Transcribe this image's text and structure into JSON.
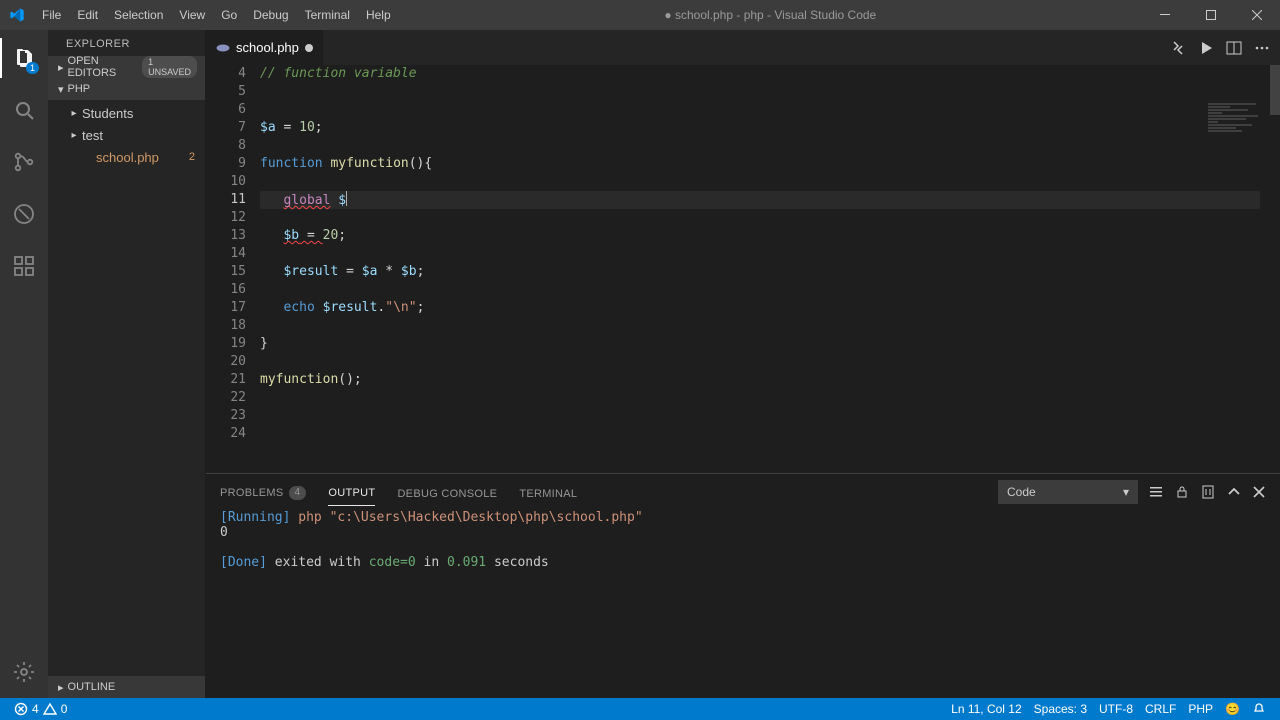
{
  "title": "● school.php - php - Visual Studio Code",
  "menus": [
    "File",
    "Edit",
    "Selection",
    "View",
    "Go",
    "Debug",
    "Terminal",
    "Help"
  ],
  "activity": {
    "explorer_badge": "1"
  },
  "sidebar": {
    "title": "EXPLORER",
    "open_editors": "OPEN EDITORS",
    "unsaved_chip": "1 UNSAVED",
    "root": "PHP",
    "items": [
      {
        "type": "folder",
        "label": "Students"
      },
      {
        "type": "folder",
        "label": "test"
      },
      {
        "type": "file",
        "label": "school.php",
        "badge": "2",
        "modified": true
      }
    ],
    "outline": "OUTLINE"
  },
  "tab": {
    "name": "school.php"
  },
  "lines": {
    "start": 4,
    "current": 11,
    "rows": [
      {
        "n": 4
      },
      {
        "n": 5
      },
      {
        "n": 6
      },
      {
        "n": 7
      },
      {
        "n": 8
      },
      {
        "n": 9
      },
      {
        "n": 10
      },
      {
        "n": 11
      },
      {
        "n": 12
      },
      {
        "n": 13
      },
      {
        "n": 14
      },
      {
        "n": 15
      },
      {
        "n": 16
      },
      {
        "n": 17
      },
      {
        "n": 18
      },
      {
        "n": 19
      },
      {
        "n": 20
      },
      {
        "n": 21
      },
      {
        "n": 22
      },
      {
        "n": 23
      },
      {
        "n": 24
      }
    ]
  },
  "code": {
    "l4_comment": "// function variable",
    "l7_var": "$a",
    "l7_num": "10",
    "l9_kw": "function",
    "l9_fn": "myfunction",
    "l11_kw": "global",
    "l11_var": "$",
    "l13_var": "$b",
    "l13_num": "20",
    "l15_var": "$result",
    "l15_a": "$a",
    "l15_b": "$b",
    "l17_echo": "echo",
    "l17_var": "$result",
    "l17_str": "\"\\n\"",
    "l21_fn": "myfunction"
  },
  "panel": {
    "tabs": {
      "problems": "PROBLEMS",
      "pcount": "4",
      "output": "OUTPUT",
      "debug": "DEBUG CONSOLE",
      "terminal": "TERMINAL"
    },
    "select": "Code",
    "output": {
      "running": "[Running]",
      "cmd": "php \"c:\\Users\\Hacked\\Desktop\\php\\school.php\"",
      "result": "0",
      "done": "[Done]",
      "tail1": " exited with ",
      "code": "code=0",
      "in": " in ",
      "time": "0.091",
      "sec": " seconds"
    }
  },
  "status": {
    "errors": "4",
    "warnings": "0",
    "pos": "Ln 11, Col 12",
    "spaces": "Spaces: 3",
    "enc": "UTF-8",
    "eol": "CRLF",
    "lang": "PHP",
    "smile": "😊"
  }
}
